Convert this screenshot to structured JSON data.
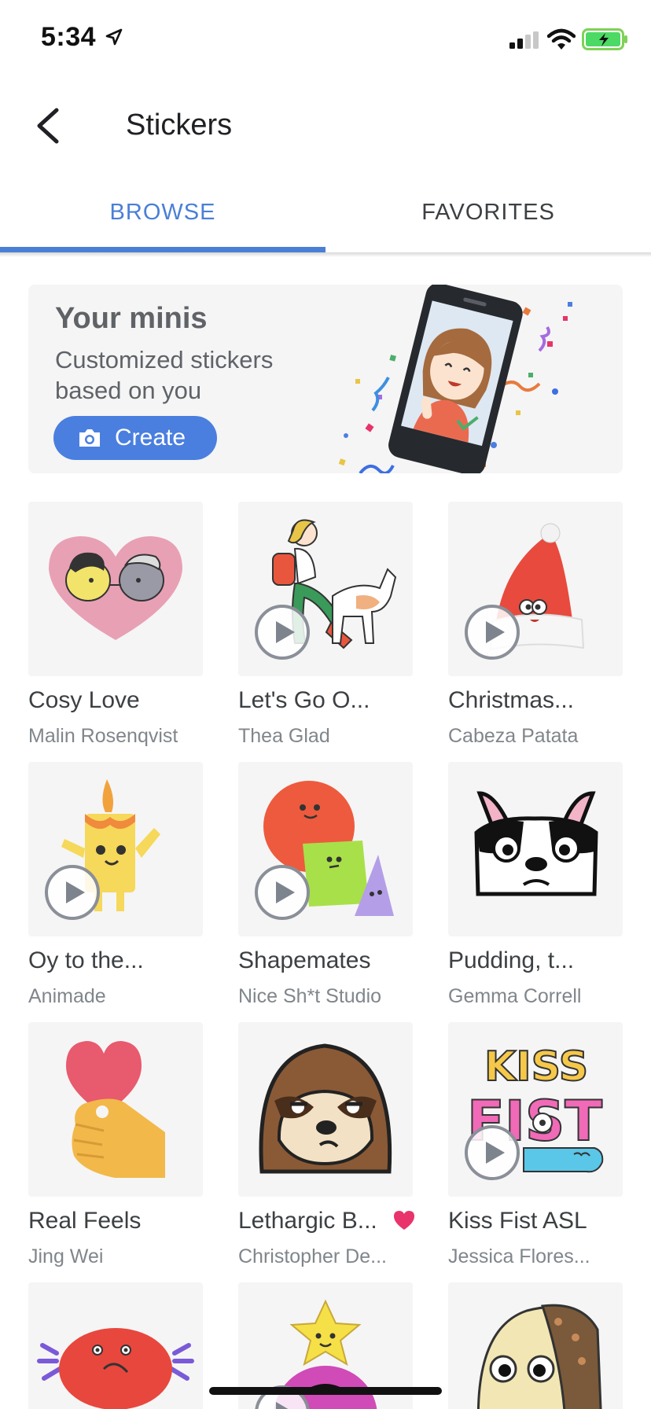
{
  "status_bar": {
    "time": "5:34"
  },
  "header": {
    "title": "Stickers"
  },
  "tabs": [
    {
      "label": "BROWSE",
      "active": true
    },
    {
      "label": "FAVORITES",
      "active": false
    }
  ],
  "minis": {
    "title": "Your minis",
    "subtitle": "Customized stickers based on you",
    "button_label": "Create"
  },
  "colors": {
    "accent": "#4a7fd6",
    "favorite_heart": "#e8336b"
  },
  "stickers": [
    {
      "name": "Cosy Love",
      "author": "Malin Rosenqvist",
      "animated": false,
      "favorite": false
    },
    {
      "name": "Let's Go O...",
      "author": "Thea Glad",
      "animated": true,
      "favorite": false
    },
    {
      "name": "Christmas...",
      "author": "Cabeza Patata",
      "animated": true,
      "favorite": false
    },
    {
      "name": "Oy to the...",
      "author": "Animade",
      "animated": true,
      "favorite": false
    },
    {
      "name": "Shapemates",
      "author": "Nice Sh*t Studio",
      "animated": true,
      "favorite": false
    },
    {
      "name": "Pudding, t...",
      "author": "Gemma Correll",
      "animated": false,
      "favorite": false
    },
    {
      "name": "Real Feels",
      "author": "Jing Wei",
      "animated": false,
      "favorite": false
    },
    {
      "name": "Lethargic B...",
      "author": "Christopher De...",
      "animated": false,
      "favorite": true
    },
    {
      "name": "Kiss Fist ASL",
      "author": "Jessica Flores...",
      "animated": true,
      "favorite": false
    },
    {
      "name": "",
      "author": "",
      "animated": false,
      "favorite": false
    },
    {
      "name": "",
      "author": "",
      "animated": true,
      "favorite": false
    },
    {
      "name": "",
      "author": "",
      "animated": false,
      "favorite": false
    }
  ]
}
